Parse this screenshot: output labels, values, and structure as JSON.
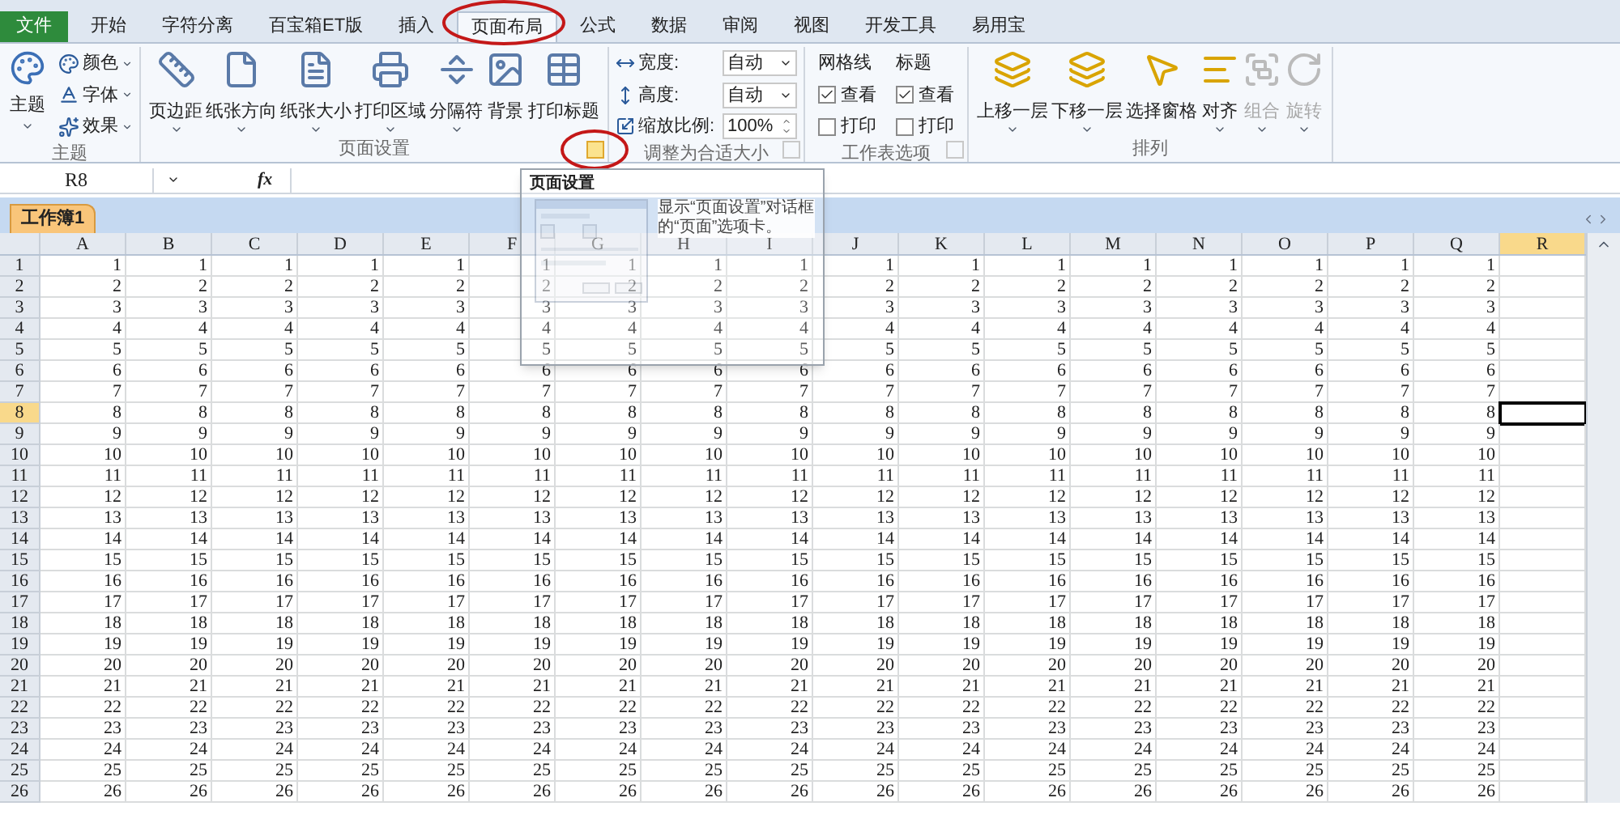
{
  "tabs": [
    {
      "label": "文件",
      "kind": "file",
      "selected": false
    },
    {
      "label": "开始",
      "kind": "tab",
      "selected": false
    },
    {
      "label": "字符分离",
      "kind": "tab",
      "selected": false
    },
    {
      "label": "百宝箱ET版",
      "kind": "tab",
      "selected": false
    },
    {
      "label": "插入",
      "kind": "tab",
      "selected": false
    },
    {
      "label": "页面布局",
      "kind": "tab",
      "selected": true
    },
    {
      "label": "公式",
      "kind": "tab",
      "selected": false
    },
    {
      "label": "数据",
      "kind": "tab",
      "selected": false
    },
    {
      "label": "审阅",
      "kind": "tab",
      "selected": false
    },
    {
      "label": "视图",
      "kind": "tab",
      "selected": false
    },
    {
      "label": "开发工具",
      "kind": "tab",
      "selected": false
    },
    {
      "label": "易用宝",
      "kind": "tab",
      "selected": false
    }
  ],
  "ribbon": {
    "groups": [
      {
        "kind": "themes",
        "title": "主题",
        "large": {
          "label": "主题"
        },
        "small": [
          {
            "label": "颜色"
          },
          {
            "label": "字体"
          },
          {
            "label": "效果"
          }
        ]
      },
      {
        "kind": "buttons",
        "title": "页面设置",
        "launcher": {
          "highlighted": true
        },
        "buttons": [
          {
            "label": "页边距",
            "dropdown": true,
            "disabled": false
          },
          {
            "label": "纸张方向",
            "dropdown": true,
            "disabled": false
          },
          {
            "label": "纸张大小",
            "dropdown": true,
            "disabled": false
          },
          {
            "label": "打印区域",
            "dropdown": true,
            "disabled": false
          },
          {
            "label": "分隔符",
            "dropdown": true,
            "disabled": false
          },
          {
            "label": "背景",
            "dropdown": false,
            "disabled": false
          },
          {
            "label": "打印标题",
            "dropdown": false,
            "disabled": false
          }
        ]
      },
      {
        "kind": "scale",
        "title": "调整为合适大小",
        "launcher": {
          "highlighted": false
        },
        "fields": [
          {
            "kind": "dropdown",
            "label": "宽度:",
            "value": "自动"
          },
          {
            "kind": "dropdown",
            "label": "高度:",
            "value": "自动"
          },
          {
            "kind": "spinner",
            "label": "缩放比例:",
            "value": "100%"
          }
        ]
      },
      {
        "kind": "sheet_options",
        "title": "工作表选项",
        "launcher": {
          "highlighted": false
        },
        "columns": [
          {
            "heading": "网格线",
            "options": [
              {
                "label": "查看",
                "checked": true
              },
              {
                "label": "打印",
                "checked": false
              }
            ]
          },
          {
            "heading": "标题",
            "options": [
              {
                "label": "查看",
                "checked": true
              },
              {
                "label": "打印",
                "checked": false
              }
            ]
          }
        ]
      },
      {
        "kind": "buttons",
        "title": "排列",
        "buttons": [
          {
            "label": "上移一层",
            "dropdown": true,
            "disabled": false
          },
          {
            "label": "下移一层",
            "dropdown": true,
            "disabled": false
          },
          {
            "label": "选择窗格",
            "dropdown": false,
            "disabled": false
          },
          {
            "label": "对齐",
            "dropdown": true,
            "disabled": false
          },
          {
            "label": "组合",
            "dropdown": true,
            "disabled": true
          },
          {
            "label": "旋转",
            "dropdown": true,
            "disabled": true
          }
        ]
      }
    ]
  },
  "formula_bar": {
    "name_box": "R8",
    "fx": "fx"
  },
  "workbook_tab": {
    "label": "工作簿1"
  },
  "sheet": {
    "columns": [
      {
        "label": "A",
        "selected": false
      },
      {
        "label": "B",
        "selected": false
      },
      {
        "label": "C",
        "selected": false
      },
      {
        "label": "D",
        "selected": false
      },
      {
        "label": "E",
        "selected": false
      },
      {
        "label": "F",
        "selected": false
      },
      {
        "label": "G",
        "selected": false
      },
      {
        "label": "H",
        "selected": false
      },
      {
        "label": "I",
        "selected": false
      },
      {
        "label": "J",
        "selected": false
      },
      {
        "label": "K",
        "selected": false
      },
      {
        "label": "L",
        "selected": false
      },
      {
        "label": "M",
        "selected": false
      },
      {
        "label": "N",
        "selected": false
      },
      {
        "label": "O",
        "selected": false
      },
      {
        "label": "P",
        "selected": false
      },
      {
        "label": "Q",
        "selected": false
      },
      {
        "label": "R",
        "selected": true
      }
    ],
    "rows": [
      {
        "header": "1",
        "selected": false,
        "cells": [
          "1",
          "1",
          "1",
          "1",
          "1",
          "1",
          "1",
          "1",
          "1",
          "1",
          "1",
          "1",
          "1",
          "1",
          "1",
          "1",
          "1"
        ]
      },
      {
        "header": "2",
        "selected": false,
        "cells": [
          "2",
          "2",
          "2",
          "2",
          "2",
          "2",
          "2",
          "2",
          "2",
          "2",
          "2",
          "2",
          "2",
          "2",
          "2",
          "2",
          "2"
        ]
      },
      {
        "header": "3",
        "selected": false,
        "cells": [
          "3",
          "3",
          "3",
          "3",
          "3",
          "3",
          "3",
          "3",
          "3",
          "3",
          "3",
          "3",
          "3",
          "3",
          "3",
          "3",
          "3"
        ]
      },
      {
        "header": "4",
        "selected": false,
        "cells": [
          "4",
          "4",
          "4",
          "4",
          "4",
          "4",
          "4",
          "4",
          "4",
          "4",
          "4",
          "4",
          "4",
          "4",
          "4",
          "4",
          "4"
        ]
      },
      {
        "header": "5",
        "selected": false,
        "cells": [
          "5",
          "5",
          "5",
          "5",
          "5",
          "5",
          "5",
          "5",
          "5",
          "5",
          "5",
          "5",
          "5",
          "5",
          "5",
          "5",
          "5"
        ]
      },
      {
        "header": "6",
        "selected": false,
        "cells": [
          "6",
          "6",
          "6",
          "6",
          "6",
          "6",
          "6",
          "6",
          "6",
          "6",
          "6",
          "6",
          "6",
          "6",
          "6",
          "6",
          "6"
        ]
      },
      {
        "header": "7",
        "selected": false,
        "cells": [
          "7",
          "7",
          "7",
          "7",
          "7",
          "7",
          "7",
          "7",
          "7",
          "7",
          "7",
          "7",
          "7",
          "7",
          "7",
          "7",
          "7"
        ]
      },
      {
        "header": "8",
        "selected": true,
        "cells": [
          "8",
          "8",
          "8",
          "8",
          "8",
          "8",
          "8",
          "8",
          "8",
          "8",
          "8",
          "8",
          "8",
          "8",
          "8",
          "8",
          "8"
        ]
      },
      {
        "header": "9",
        "selected": false,
        "cells": [
          "9",
          "9",
          "9",
          "9",
          "9",
          "9",
          "9",
          "9",
          "9",
          "9",
          "9",
          "9",
          "9",
          "9",
          "9",
          "9",
          "9"
        ]
      },
      {
        "header": "10",
        "selected": false,
        "cells": [
          "10",
          "10",
          "10",
          "10",
          "10",
          "10",
          "10",
          "10",
          "10",
          "10",
          "10",
          "10",
          "10",
          "10",
          "10",
          "10",
          "10"
        ]
      },
      {
        "header": "11",
        "selected": false,
        "cells": [
          "11",
          "11",
          "11",
          "11",
          "11",
          "11",
          "11",
          "11",
          "11",
          "11",
          "11",
          "11",
          "11",
          "11",
          "11",
          "11",
          "11"
        ]
      },
      {
        "header": "12",
        "selected": false,
        "cells": [
          "12",
          "12",
          "12",
          "12",
          "12",
          "12",
          "12",
          "12",
          "12",
          "12",
          "12",
          "12",
          "12",
          "12",
          "12",
          "12",
          "12"
        ]
      },
      {
        "header": "13",
        "selected": false,
        "cells": [
          "13",
          "13",
          "13",
          "13",
          "13",
          "13",
          "13",
          "13",
          "13",
          "13",
          "13",
          "13",
          "13",
          "13",
          "13",
          "13",
          "13"
        ]
      },
      {
        "header": "14",
        "selected": false,
        "cells": [
          "14",
          "14",
          "14",
          "14",
          "14",
          "14",
          "14",
          "14",
          "14",
          "14",
          "14",
          "14",
          "14",
          "14",
          "14",
          "14",
          "14"
        ]
      },
      {
        "header": "15",
        "selected": false,
        "cells": [
          "15",
          "15",
          "15",
          "15",
          "15",
          "15",
          "15",
          "15",
          "15",
          "15",
          "15",
          "15",
          "15",
          "15",
          "15",
          "15",
          "15"
        ]
      },
      {
        "header": "16",
        "selected": false,
        "cells": [
          "16",
          "16",
          "16",
          "16",
          "16",
          "16",
          "16",
          "16",
          "16",
          "16",
          "16",
          "16",
          "16",
          "16",
          "16",
          "16",
          "16"
        ]
      },
      {
        "header": "17",
        "selected": false,
        "cells": [
          "17",
          "17",
          "17",
          "17",
          "17",
          "17",
          "17",
          "17",
          "17",
          "17",
          "17",
          "17",
          "17",
          "17",
          "17",
          "17",
          "17"
        ]
      },
      {
        "header": "18",
        "selected": false,
        "cells": [
          "18",
          "18",
          "18",
          "18",
          "18",
          "18",
          "18",
          "18",
          "18",
          "18",
          "18",
          "18",
          "18",
          "18",
          "18",
          "18",
          "18"
        ]
      },
      {
        "header": "19",
        "selected": false,
        "cells": [
          "19",
          "19",
          "19",
          "19",
          "19",
          "19",
          "19",
          "19",
          "19",
          "19",
          "19",
          "19",
          "19",
          "19",
          "19",
          "19",
          "19"
        ]
      },
      {
        "header": "20",
        "selected": false,
        "cells": [
          "20",
          "20",
          "20",
          "20",
          "20",
          "20",
          "20",
          "20",
          "20",
          "20",
          "20",
          "20",
          "20",
          "20",
          "20",
          "20",
          "20"
        ]
      },
      {
        "header": "21",
        "selected": false,
        "cells": [
          "21",
          "21",
          "21",
          "21",
          "21",
          "21",
          "21",
          "21",
          "21",
          "21",
          "21",
          "21",
          "21",
          "21",
          "21",
          "21",
          "21"
        ]
      },
      {
        "header": "22",
        "selected": false,
        "cells": [
          "22",
          "22",
          "22",
          "22",
          "22",
          "22",
          "22",
          "22",
          "22",
          "22",
          "22",
          "22",
          "22",
          "22",
          "22",
          "22",
          "22"
        ]
      },
      {
        "header": "23",
        "selected": false,
        "cells": [
          "23",
          "23",
          "23",
          "23",
          "23",
          "23",
          "23",
          "23",
          "23",
          "23",
          "23",
          "23",
          "23",
          "23",
          "23",
          "23",
          "23"
        ]
      },
      {
        "header": "24",
        "selected": false,
        "cells": [
          "24",
          "24",
          "24",
          "24",
          "24",
          "24",
          "24",
          "24",
          "24",
          "24",
          "24",
          "24",
          "24",
          "24",
          "24",
          "24",
          "24"
        ]
      },
      {
        "header": "25",
        "selected": false,
        "cells": [
          "25",
          "25",
          "25",
          "25",
          "25",
          "25",
          "25",
          "25",
          "25",
          "25",
          "25",
          "25",
          "25",
          "25",
          "25",
          "25",
          "25"
        ]
      },
      {
        "header": "26",
        "selected": false,
        "cells": [
          "26",
          "26",
          "26",
          "26",
          "26",
          "26",
          "26",
          "26",
          "26",
          "26",
          "26",
          "26",
          "26",
          "26",
          "26",
          "26",
          "26"
        ]
      }
    ]
  },
  "tooltip": {
    "title": "页面设置",
    "text": "显示“页面设置”对话框的“页面”选项卡。"
  }
}
